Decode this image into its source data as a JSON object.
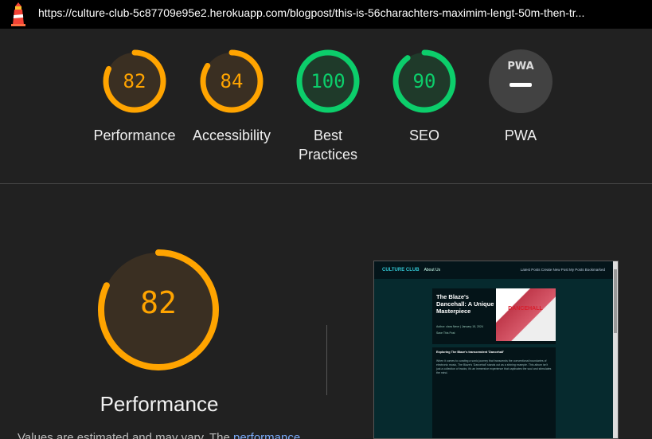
{
  "topbar": {
    "url": "https://culture-club-5c87709e95e2.herokuapp.com/blogpost/this-is-56charachters-maximim-lengt-50m-then-tr..."
  },
  "colors": {
    "average": "#ffa400",
    "pass": "#0cce6b",
    "na": "#424242"
  },
  "gauges": [
    {
      "label": "Performance",
      "score": "82",
      "value": 82,
      "status": "average"
    },
    {
      "label": "Accessibility",
      "score": "84",
      "value": 84,
      "status": "average"
    },
    {
      "label": "Best Practices",
      "score": "100",
      "value": 100,
      "status": "pass"
    },
    {
      "label": "SEO",
      "score": "90",
      "value": 90,
      "status": "pass"
    },
    {
      "label": "PWA",
      "score": "",
      "value": 0,
      "status": "na",
      "badge": "PWA"
    }
  ],
  "main": {
    "score": "82",
    "value": 82,
    "label": "Performance",
    "desc_prefix": "Values are estimated and may vary. The",
    "desc_link": "performance"
  },
  "screenshot": {
    "brand": "CULTURE CLUB",
    "about": "About Us",
    "links": "Latest Posts   Create New Post   My Posts   Bookmarked",
    "hero_title": "The Blaze's Dancehall: A Unique Masterpiece",
    "hero_meta": "Author: clara Neve | January 15, 2024",
    "hero_save": "Save This Post",
    "hero_img_text": "DANCEHALL",
    "body_head": "Exploring The Blaze's transcendent 'Dancehall'",
    "body_text": "When it comes to curating a sonic journey that transcends the conventional boundaries of electronic music, The Blaze's 'Dancehall' stands out as a shining example. This album isn't just a collection of tracks; it's an immersive experience that captivates the soul and stimulates the mind."
  }
}
